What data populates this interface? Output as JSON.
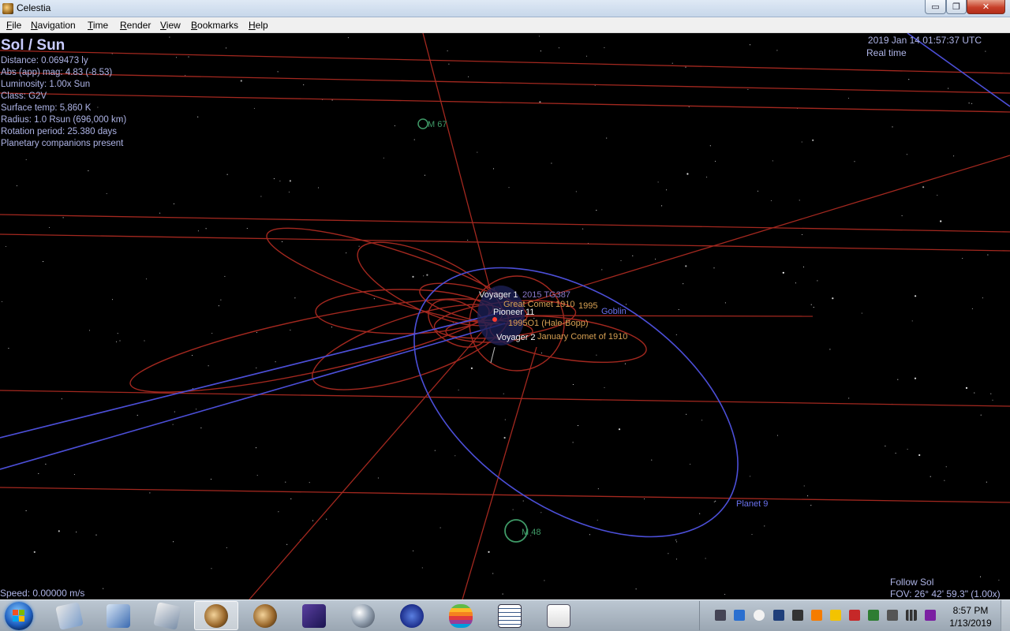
{
  "window": {
    "title": "Celestia",
    "minimize_glyph": "▭",
    "maximize_glyph": "❐",
    "close_glyph": "✕"
  },
  "menu": {
    "items": [
      {
        "label": "File",
        "key": "F",
        "rest": "ile"
      },
      {
        "label": "Navigation",
        "key": "N",
        "rest": "avigation"
      },
      {
        "label": "Time",
        "key": "T",
        "rest": "ime"
      },
      {
        "label": "Render",
        "key": "R",
        "rest": "ender"
      },
      {
        "label": "View",
        "key": "V",
        "rest": "iew"
      },
      {
        "label": "Bookmarks",
        "key": "B",
        "rest": "ookmarks"
      },
      {
        "label": "Help",
        "key": "H",
        "rest": "elp"
      }
    ]
  },
  "hud": {
    "selection": "Sol / Sun",
    "info": [
      "Distance: 0.069473 ly",
      "Abs (app) mag: 4.83 (-8.53)",
      "Luminosity: 1.00x Sun",
      "Class: G2V",
      "Surface temp: 5,860 K",
      "Radius: 1.0 Rsun  (696,000 km)",
      "Rotation period: 25.380 days",
      "Planetary companions present"
    ],
    "datetime": "2019 Jan 14 01:57:37 UTC",
    "time_mode": "Real time",
    "speed": "Speed: 0.00000 m/s",
    "follow": "Follow Sol",
    "fov": "FOV: 26° 42' 59.3\" (1.00x)"
  },
  "labels": {
    "m67": "M 67",
    "m48": "M 48",
    "voyager1": "Voyager 1",
    "voyager2": "Voyager 2",
    "pioneer11": "Pioneer 11",
    "great_comet": "Great Comet 1910",
    "hale_bopp": "1995O1 (Hale-Bopp)",
    "jan_comet": "January Comet of 1910",
    "planet9": "Planet 9",
    "goblin": "Goblin",
    "num_a": "1995",
    "num_b": "2015 TG387"
  },
  "taskbar": {
    "clock_time": "8:57 PM",
    "clock_date": "1/13/2019",
    "apps": [
      "maps-app",
      "images-app",
      "utility-app",
      "celestia-active",
      "celestia-2",
      "night-sky-app",
      "sphere-app",
      "molecule-app",
      "apple-app",
      "calendar-app",
      "document-app"
    ]
  },
  "colors": {
    "orbit_red": "#a3281f",
    "orbit_blue": "#4c4fd8",
    "label_orange": "#d6a053",
    "label_blue": "#6a72ee",
    "label_green": "#3f9a67"
  }
}
